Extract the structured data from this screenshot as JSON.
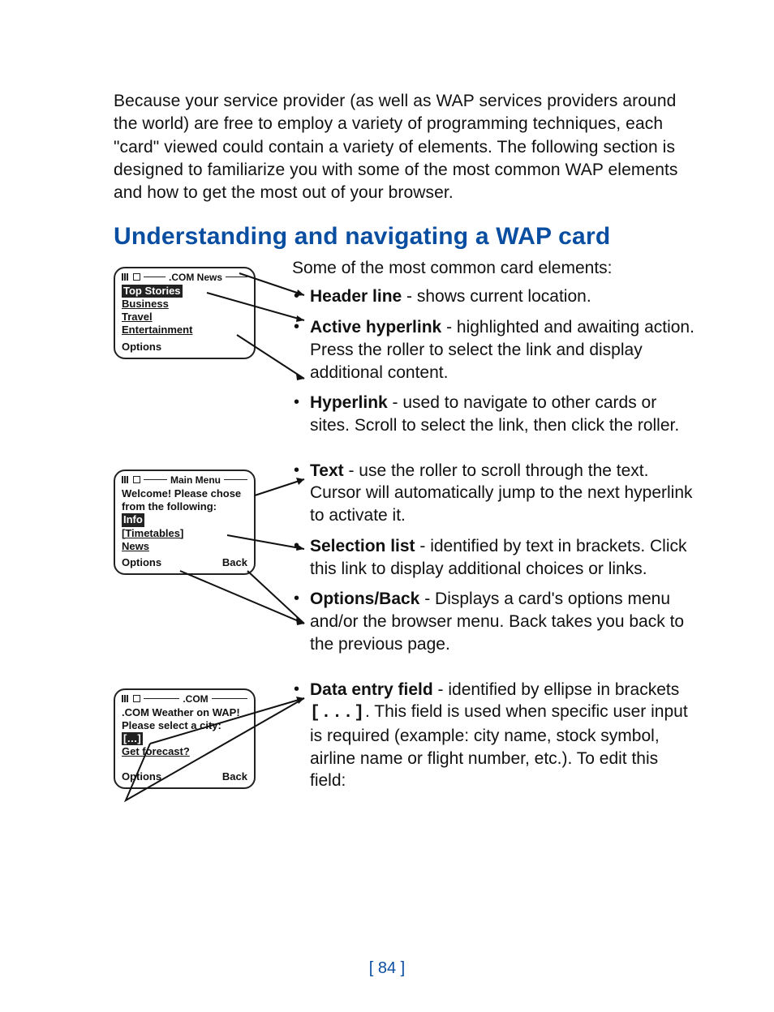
{
  "intro": "Because your service provider (as well as WAP services providers around the world) are free to employ a variety of programming techniques, each \"card\" viewed could contain a variety of elements. The following section is designed to familiarize you with some of the most common WAP elements and how to get the most out of your browser.",
  "heading": "Understanding and navigating a WAP card",
  "lead": "Some of the most common card elements:",
  "bullets1": [
    {
      "term": "Header line",
      "desc": " - shows current location."
    },
    {
      "term": "Active hyperlink",
      "desc": " - highlighted and awaiting action. Press the roller to select the link and display additional content."
    },
    {
      "term": "Hyperlink",
      "desc": " - used to navigate to other cards or sites. Scroll to select the link, then click the roller."
    }
  ],
  "bullets2": [
    {
      "term": "Text",
      "desc": " - use the roller to scroll through the text. Cursor will automatically jump to the next hyperlink to activate it."
    },
    {
      "term": "Selection list",
      "desc": " - identified by text in brackets. Click this link to display additional choices or links."
    },
    {
      "term": "Options/Back",
      "desc": " - Displays a card's options menu and/or the browser menu. Back takes you back to the previous page."
    }
  ],
  "bullets3": [
    {
      "term": "Data entry field",
      "desc_before": " - identified by ellipse in brackets ",
      "code": "[...]",
      "desc_after": ". This field is used when specific user input is required (example: city name, stock symbol, airline name or flight number, etc.). To edit this field:"
    }
  ],
  "screen1": {
    "title": ".COM News",
    "active": "Top Stories",
    "links": [
      "Business",
      "Travel",
      "Entertainment"
    ],
    "left": "Options"
  },
  "screen2": {
    "title": "Main Menu",
    "text1": "Welcome! Please chose",
    "text2": "from the following:",
    "active": "Info",
    "bracket": "[Timetables]",
    "link": "News",
    "left": "Options",
    "right": "Back"
  },
  "screen3": {
    "title": ".COM",
    "text1": ".COM Weather on WAP!",
    "text2": "Please select a city:",
    "field": "[…]",
    "link": "Get forecast?",
    "left": "Options",
    "right": "Back"
  },
  "page_number": "[ 84 ]"
}
